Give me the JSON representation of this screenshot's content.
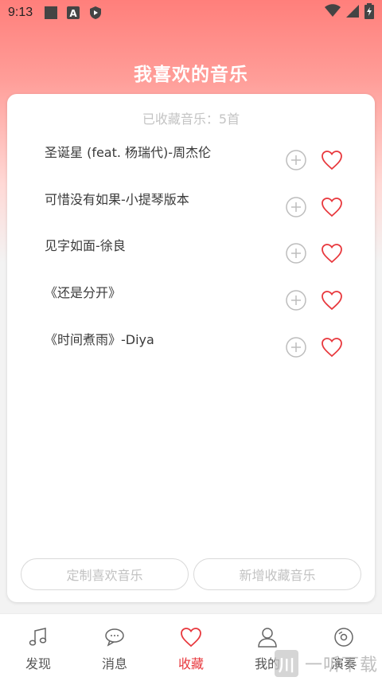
{
  "status_bar": {
    "time": "9:13",
    "icons": [
      "square-icon",
      "a-badge-icon",
      "shield-icon"
    ],
    "right_icons": [
      "wifi-icon",
      "signal-icon",
      "battery-icon"
    ]
  },
  "header": {
    "title": "我喜欢的音乐"
  },
  "card": {
    "count_text": "已收藏音乐：5首",
    "songs": [
      {
        "title": "圣诞星 (feat. 杨瑞代)-周杰伦"
      },
      {
        "title": "可惜没有如果-小提琴版本"
      },
      {
        "title": "见字如面-徐良"
      },
      {
        "title": "《还是分开》"
      },
      {
        "title": "《时间煮雨》-Diya"
      }
    ],
    "customize_button": "定制喜欢音乐",
    "add_button": "新增收藏音乐"
  },
  "tabs": [
    {
      "label": "发现",
      "icon": "music-note-icon"
    },
    {
      "label": "消息",
      "icon": "chat-bubble-icon"
    },
    {
      "label": "收藏",
      "icon": "heart-icon",
      "active": true
    },
    {
      "label": "我的",
      "icon": "user-icon"
    },
    {
      "label": "演奏",
      "icon": "disc-icon"
    }
  ],
  "watermark": {
    "text": "一听下载",
    "logo": "川"
  },
  "colors": {
    "accent": "#e8383d",
    "header_top": "#ff7f7b",
    "icon_gray": "#bdbdbd"
  }
}
